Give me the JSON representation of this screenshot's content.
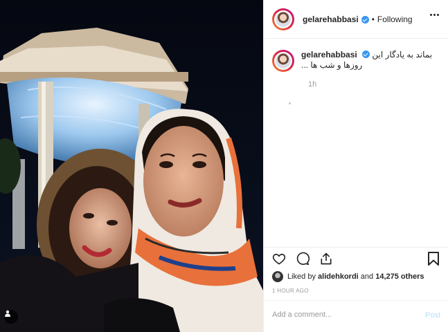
{
  "post": {
    "username": "gelarehabbasi",
    "follow_status": "Following",
    "separator": "•",
    "caption": {
      "username": "gelarehabbasi",
      "text": "بماند به یادگار این روزها و شب ها ...",
      "time_ago": "1h"
    },
    "likes": {
      "prefix": "Liked by",
      "user": "alidehkordi",
      "connector": "and",
      "count": "14,275 others"
    },
    "posted_ago": "1 HOUR AGO",
    "comment": {
      "placeholder": "Add a comment...",
      "post_label": "Post"
    }
  },
  "icons": {
    "verified": "verified-badge-icon",
    "more": "more-options-icon",
    "like": "heart-icon",
    "comment": "comment-icon",
    "share": "share-icon",
    "save": "bookmark-icon",
    "tag": "tagged-user-icon"
  },
  "colors": {
    "verified": "#3897f0",
    "post_disabled": "#b2dffc",
    "muted_text": "#999999",
    "border": "#efefef"
  }
}
